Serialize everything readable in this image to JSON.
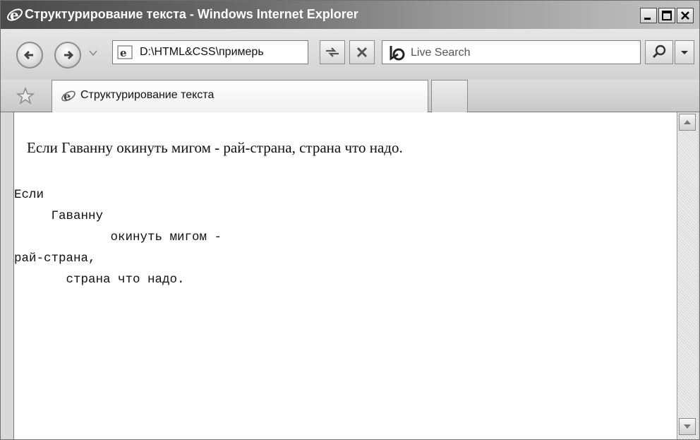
{
  "window": {
    "title": "Структурирование текста - Windows Internet Explorer"
  },
  "navigation": {
    "address": "D:\\HTML&CSS\\примерь",
    "search_placeholder": "Live Search"
  },
  "tabs": [
    {
      "label": "Структурирование текста",
      "active": true
    }
  ],
  "content": {
    "paragraph": "Если Гаванну окинуть мигом - рай-страна, страна что надо.",
    "preformatted": "Если\n     Гаванну\n             окинуть мигом -\nрай-страна,\n       страна что надо."
  },
  "icons": [
    "ie-logo-icon",
    "minimize-icon",
    "maximize-icon",
    "close-icon",
    "back-icon",
    "forward-icon",
    "history-dropdown-icon",
    "page-icon",
    "refresh-icon",
    "stop-icon",
    "bing-logo-icon",
    "search-icon",
    "search-options-icon",
    "favorites-star-icon",
    "scroll-up-icon",
    "scroll-down-icon"
  ]
}
